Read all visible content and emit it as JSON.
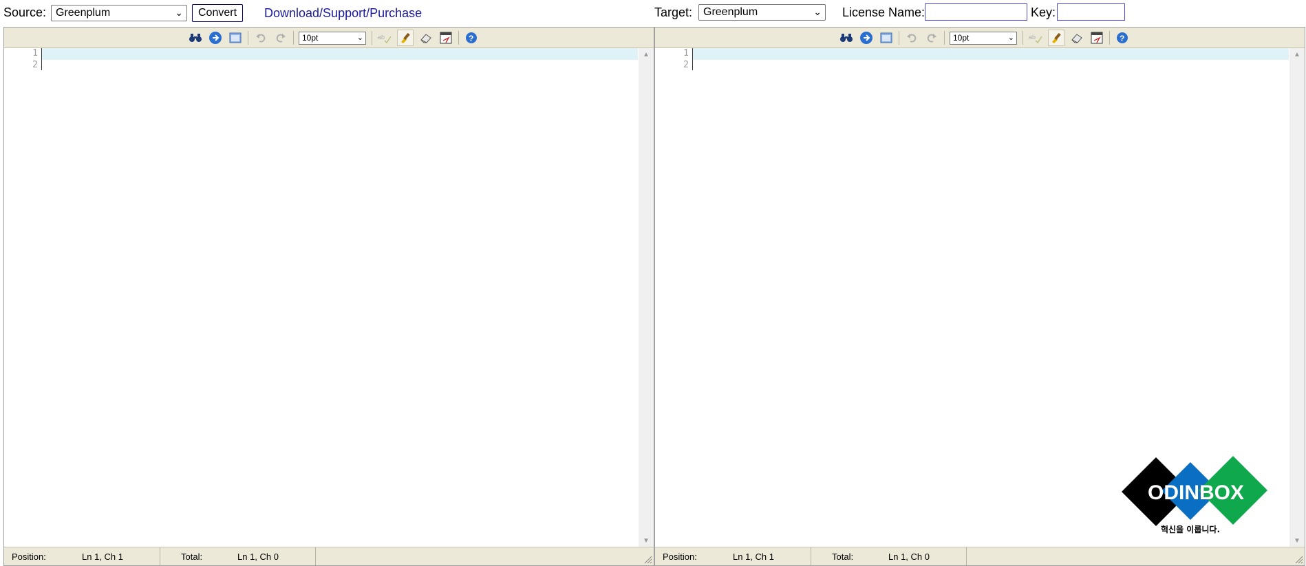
{
  "top": {
    "source_label": "Source:",
    "source_value": "Greenplum",
    "convert_label": "Convert",
    "link_text": "Download/Support/Purchase",
    "target_label": "Target:",
    "target_value": "Greenplum",
    "license_label": "License Name:",
    "license_value": "",
    "key_label": "Key:",
    "key_value": ""
  },
  "toolbar": {
    "font_size": "10pt",
    "icons": [
      "search-icon",
      "goto-line-icon",
      "fullscreen-icon",
      "undo-icon",
      "redo-icon",
      "font-size-select",
      "spell-check-icon",
      "highlight-icon",
      "reset-icon",
      "syntax-icon",
      "help-icon"
    ]
  },
  "editors": [
    {
      "lines": [
        "1",
        "2"
      ],
      "status": {
        "position_label": "Position:",
        "position_value": "Ln 1, Ch 1",
        "total_label": "Total:",
        "total_value": "Ln 1, Ch 0"
      }
    },
    {
      "lines": [
        "1",
        "2"
      ],
      "status": {
        "position_label": "Position:",
        "position_value": "Ln 1, Ch 1",
        "total_label": "Total:",
        "total_value": "Ln 1, Ch 0"
      }
    }
  ],
  "logo": {
    "brand": "ODINBOX",
    "tagline": "혁신을 이룹니다.",
    "colors": [
      "#000000",
      "#0a6fc2",
      "#10a84c"
    ]
  }
}
